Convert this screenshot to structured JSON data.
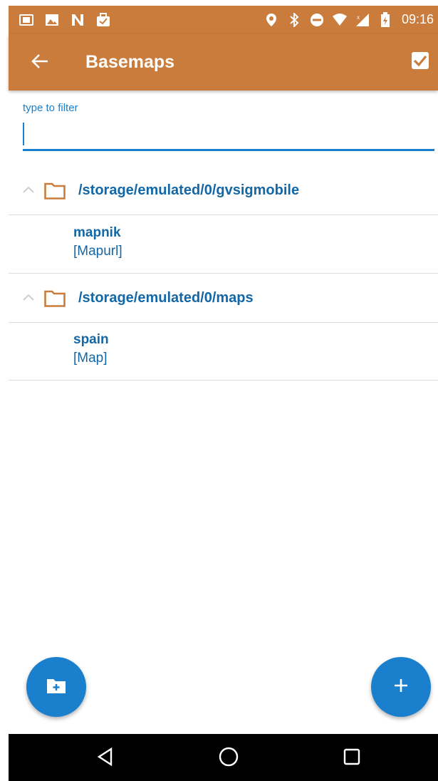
{
  "statusbar": {
    "left_icons": [
      "book-icon",
      "image-icon",
      "n-icon",
      "briefcase-check-icon"
    ],
    "right_icons": [
      "location-icon",
      "bluetooth-icon",
      "do-not-disturb-icon",
      "wifi-icon",
      "signal-icon",
      "battery-icon"
    ],
    "time": "09:16"
  },
  "toolbar": {
    "title": "Basemaps",
    "back_icon": "arrow-left-icon",
    "confirm_icon": "checkbox-checked-icon"
  },
  "filter": {
    "label": "type to filter",
    "value": ""
  },
  "groups": [
    {
      "path": "/storage/emulated/0/gvsigmobile",
      "items": [
        {
          "name": "mapnik",
          "type": "[Mapurl]"
        }
      ]
    },
    {
      "path": "/storage/emulated/0/maps",
      "items": [
        {
          "name": "spain",
          "type": "[Map]"
        }
      ]
    }
  ],
  "fabs": {
    "left_icon": "add-folder-icon",
    "right_icon": "plus-icon"
  },
  "navbar": {
    "icons": [
      "back-triangle-icon",
      "home-circle-icon",
      "recents-square-icon"
    ]
  },
  "colors": {
    "primary": "#c97c3b",
    "accent": "#1a7fcc",
    "text_blue": "#1367a6"
  }
}
